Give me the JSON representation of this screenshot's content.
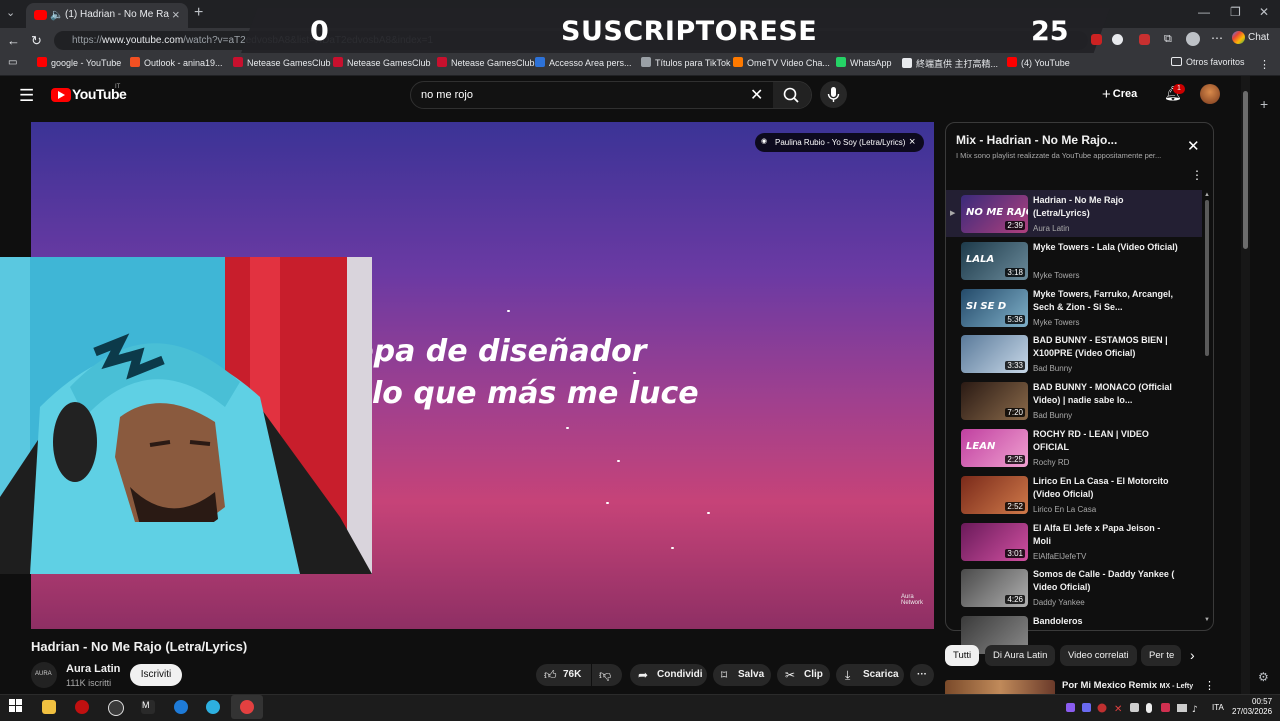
{
  "browser": {
    "tab_title": "(1) Hadrian - No Me Rajo (Letra/Lyrics)",
    "url_prefix": "https://",
    "url_host": "www.youtube.com",
    "url_path": "/watch?v=aT2edvosbA8&list=RDaT2edvosbA8&index=1",
    "chat_label": "Chat",
    "new_tab": "+",
    "bookmarks": [
      {
        "label": "google - YouTube",
        "color": "#ff0000"
      },
      {
        "label": "Outlook - anina19...",
        "color": "#f25022"
      },
      {
        "label": "Netease GamesClub",
        "color": "#c8102e"
      },
      {
        "label": "Netease GamesClub",
        "color": "#c8102e"
      },
      {
        "label": "Netease GamesClub",
        "color": "#c8102e"
      },
      {
        "label": "Accesso Area pers...",
        "color": "#2d72d9"
      },
      {
        "label": "Títulos para TikTok",
        "color": "#9aa0a6"
      },
      {
        "label": "OmeTV Video Cha...",
        "color": "#ff7a00"
      },
      {
        "label": "WhatsApp",
        "color": "#25d366"
      },
      {
        "label": "終端直供 主打高精...",
        "color": "#e8eaed"
      },
      {
        "label": "(4) YouTube",
        "color": "#ff0000"
      }
    ],
    "other_favorites": "Otros favoritos"
  },
  "stream_overlay": {
    "left_count": "0",
    "title": "SUSCRIPTORESE",
    "right_count": "25"
  },
  "youtube": {
    "logo_text": "YouTube",
    "logo_country": "IT",
    "search_value": "no me rojo",
    "create_label": "Crea",
    "notifications_count": "1"
  },
  "video": {
    "lyric_line1": "opa de diseñador",
    "lyric_line2": "lo que más me luce",
    "up_next_chip": "Paulina Rubio - Yo Soy (Letra/Lyrics)",
    "watermark_line1": "Aura",
    "watermark_line2": "Network",
    "title": "Hadrian - No Me Rajo (Letra/Lyrics)",
    "channel": "Aura Latin",
    "subscribers": "111K iscritti",
    "subscribe_label": "Iscriviti",
    "likes": "76K",
    "share_label": "Condividi",
    "save_label": "Salva",
    "clip_label": "Clip",
    "download_label": "Scarica",
    "more_label": "···"
  },
  "playlist": {
    "title": "Mix - Hadrian - No Me Rajo...",
    "subtitle": "I Mix sono playlist realizzate da YouTube appositamente per...",
    "items": [
      {
        "title": "Hadrian - No Me Rajo (Letra/Lyrics)",
        "channel": "Aura Latin",
        "duration": "2:39",
        "thumb_caption": "NO ME RAJO",
        "color1": "#3a2a7a",
        "color2": "#b0407e"
      },
      {
        "title": "Myke Towers - Lala (Video Oficial)",
        "channel": "Myke Towers",
        "duration": "3:18",
        "thumb_caption": "LALA",
        "color1": "#1d3a4a",
        "color2": "#6a8a9a"
      },
      {
        "title": "Myke Towers, Farruko, Arcangel, Sech & Zion - Si Se...",
        "channel": "Myke Towers",
        "duration": "5:36",
        "thumb_caption": "SI SE D",
        "color1": "#244a6a",
        "color2": "#7fb0c8"
      },
      {
        "title": "BAD BUNNY - ESTAMOS BIEN | X100PRE (Video Oficial)",
        "channel": "Bad Bunny",
        "duration": "3:33",
        "thumb_caption": "",
        "color1": "#5a7a9a",
        "color2": "#c8d8e8"
      },
      {
        "title": "BAD BUNNY - MONACO (Official Video) | nadie sabe lo...",
        "channel": "Bad Bunny",
        "duration": "7:20",
        "thumb_caption": "",
        "color1": "#2a1a14",
        "color2": "#8a6a4a"
      },
      {
        "title": "ROCHY RD - LEAN | VIDEO OFICIAL",
        "channel": "Rochy RD",
        "duration": "2:25",
        "thumb_caption": "LEAN",
        "color1": "#c040a0",
        "color2": "#f0a0d0"
      },
      {
        "title": "Lirico En La Casa - El Motorcito (Video Oficial)",
        "channel": "Lirico En La Casa",
        "duration": "2:52",
        "thumb_caption": "",
        "color1": "#7a2a1a",
        "color2": "#d07a4a"
      },
      {
        "title": "El Alfa El Jefe x Papa Jeison - Moli",
        "channel": "ElAlfaElJefeTV",
        "duration": "3:01",
        "thumb_caption": "",
        "color1": "#6a1a5a",
        "color2": "#d050a0"
      },
      {
        "title": "Somos de Calle - Daddy Yankee ( Video Oficial)",
        "channel": "Daddy Yankee",
        "duration": "4:26",
        "thumb_caption": "",
        "color1": "#4a4a4a",
        "color2": "#b0b0b0"
      },
      {
        "title": "Bandoleros",
        "channel": "",
        "duration": "",
        "thumb_caption": "",
        "color1": "#3a3a3a",
        "color2": "#8a8a8a"
      }
    ]
  },
  "chips": [
    "Tutti",
    "Di Aura Latin",
    "Video correlati",
    "Per te"
  ],
  "next_video_title": "Por Mi Mexico Remix",
  "next_video_suffix": "MX - Lefty",
  "taskbar": {
    "language": "ITA",
    "time": "00:57",
    "date": "27/03/2026"
  }
}
